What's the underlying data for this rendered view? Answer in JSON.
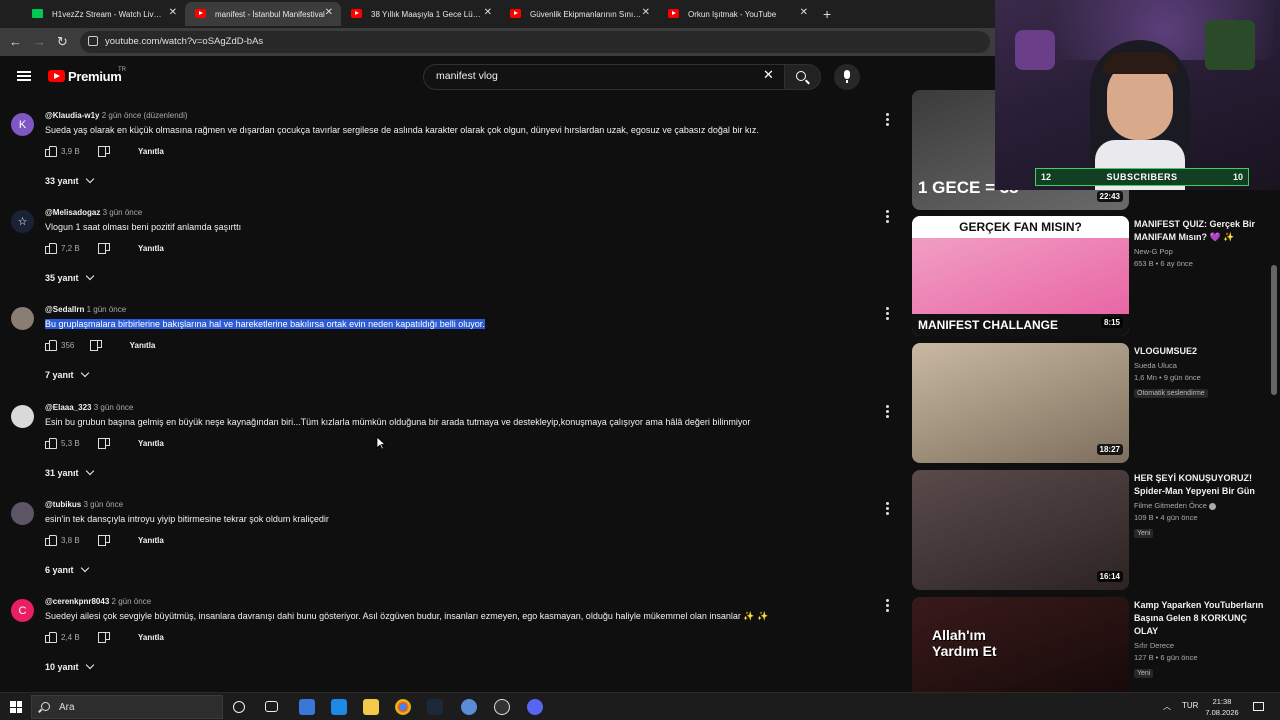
{
  "browser": {
    "tabs": [
      {
        "title": "H1vezZz Stream - Watch Live o",
        "active": false,
        "icon": "twitch-icon"
      },
      {
        "title": "manifest - İstanbul Manifestival",
        "active": true,
        "icon": "youtube-icon"
      },
      {
        "title": "38 Yıllık Maaşıyla 1 Gece Lüks O",
        "active": false,
        "icon": "youtube-icon"
      },
      {
        "title": "Güvenlik Ekipmanlarının Sınırları",
        "active": false,
        "icon": "youtube-icon"
      },
      {
        "title": "Orkun Işıtmak - YouTube",
        "active": false,
        "icon": "youtube-icon"
      }
    ],
    "url": "youtube.com/watch?v=oSAgZdD-bAs"
  },
  "youtube": {
    "brand": "Premium",
    "country": "TR",
    "search_query": "manifest vlog"
  },
  "comments": [
    {
      "avatar_letter": "K",
      "avatar_color": "#7e57c2",
      "handle": "@Klaudia-w1y",
      "time": "2 gün önce (düzenlendi)",
      "text": "Sueda yaş olarak en küçük olmasına rağmen ve dışardan çocukça tavırlar sergilese de aslında karakter olarak çok olgun, dünyevi hırslardan uzak, egosuz ve çabasız doğal bir kız.",
      "likes": "3,9 B",
      "replies": "33 yanıt",
      "selected": false
    },
    {
      "avatar_letter": "☆",
      "avatar_color": "#1b2236",
      "handle": "@Melisadogaz",
      "time": "3 gün önce",
      "text": "Vlogun 1 saat olması beni pozitif anlamda şaşırttı",
      "likes": "7,2 B",
      "replies": "35 yanıt",
      "selected": false
    },
    {
      "avatar_letter": "",
      "avatar_color": "#8a7d74",
      "handle": "@Sedallrn",
      "time": "1 gün önce",
      "text": "Bu gruplaşmalara birbirlerine bakışlarına hal ve hareketlerine bakılırsa ortak evin neden kapatıldığı belli oluyor.",
      "likes": "356",
      "replies": "7 yanıt",
      "selected": true
    },
    {
      "avatar_letter": "",
      "avatar_color": "#d9d9d9",
      "handle": "@Elaaa_323",
      "time": "3 gün önce",
      "text": "Esin bu grubun başına gelmiş en büyük neşe kaynağından biri...Tüm kızlarla mümkün olduğuna bir arada tutmaya ve destekleyip,konuşmaya çalışıyor ama hâlâ değeri bilinmiyor",
      "likes": "5,3 B",
      "replies": "31 yanıt",
      "selected": false
    },
    {
      "avatar_letter": "",
      "avatar_color": "#5b5566",
      "handle": "@tubikus",
      "time": "3 gün önce",
      "text": "esin'in tek dansçıyla introyu yiyip bitirmesine tekrar şok oldum kraliçedir",
      "likes": "3,8 B",
      "replies": "6 yanıt",
      "selected": false
    },
    {
      "avatar_letter": "C",
      "avatar_color": "#e91e63",
      "handle": "@cerenkpnr8043",
      "time": "2 gün önce",
      "text": "Suedeyi ailesi çok sevgiyle büyütmüş, insanlara davranışı dahi bunu gösteriyor. Asıl özgüven budur, insanları ezmeyen, ego kasmayan, olduğu haliyle mükemmel olan insanlar ✨ ✨",
      "likes": "2,4 B",
      "replies": "10 yanıt",
      "selected": false
    }
  ],
  "labels": {
    "reply": "Yanıtla"
  },
  "videos": [
    {
      "title": "",
      "channel": "",
      "meta": "",
      "badge": "",
      "duration": "22:43",
      "thumb_overlay": "1 GECE = 38",
      "thumb_colors": [
        "#3b3b3b",
        "#6a6a6a"
      ]
    },
    {
      "title": "MANIFEST QUIZ: Gerçek Bir MANIFAM Mısın? 💜 ✨",
      "channel": "New-G Pop",
      "meta": "653 B  •  6 ay önce",
      "badge": "",
      "duration": "8:15",
      "thumb_overlay": "GERÇEK FAN MISIN?",
      "thumb_overlay2": "MANIFEST CHALLANGE",
      "thumb_colors": [
        "#f2a6c8",
        "#e75ea0"
      ]
    },
    {
      "title": "VLOGUMSUE2",
      "channel": "Sueda Uluca",
      "meta": "1,6 Mn  •  9 gün önce",
      "badge": "Otomatik seslendirme",
      "duration": "18:27",
      "thumb_colors": [
        "#c9b9a2",
        "#7d6f5d"
      ]
    },
    {
      "title": "HER ŞEYİ KONUŞUYORUZ! Spider-Man Yepyeni Bir Gün",
      "channel": "Filme Gitmeden Önce",
      "meta": "109 B  •  4 gün önce",
      "badge": "Yeni",
      "duration": "16:14",
      "thumb_colors": [
        "#5a4b4b",
        "#2d2323"
      ]
    },
    {
      "title": "Kamp Yaparken YouTuberların Başına Gelen 8 KORKUNÇ OLAY",
      "channel": "Sıfır Derece",
      "meta": "127 B  •  6 gün önce",
      "badge": "Yeni",
      "duration": "",
      "thumb_overlay": "Allah'ım Yardım Et",
      "thumb_colors": [
        "#3a1a1a",
        "#120808"
      ]
    }
  ],
  "overlay": {
    "subs_left": "12",
    "subs_label": "SUBSCRIBERS",
    "subs_right": "10"
  },
  "taskbar": {
    "search_placeholder": "Ara",
    "language": "TUR",
    "time": "21:38",
    "date": "7.08.2026"
  }
}
